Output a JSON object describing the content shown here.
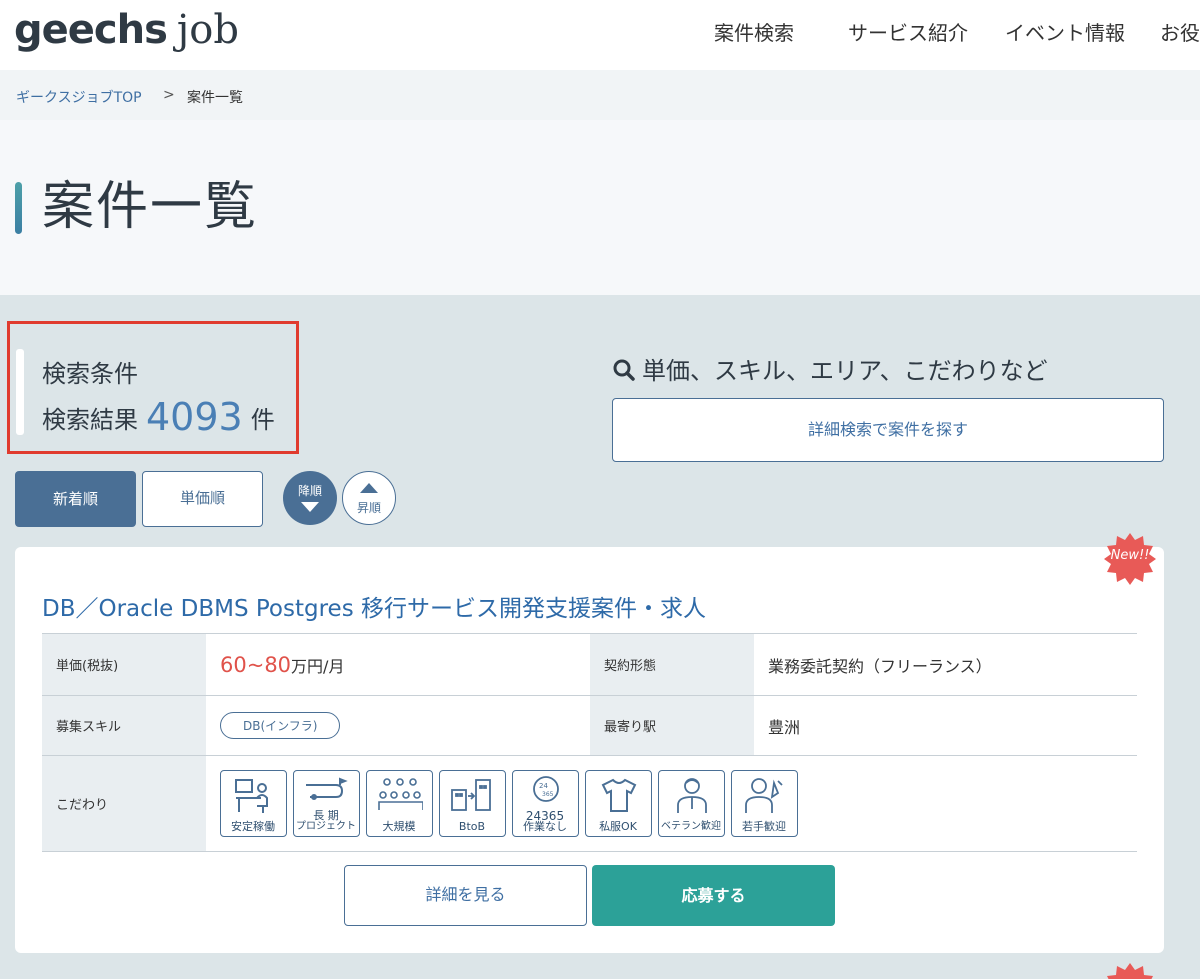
{
  "header": {
    "logo_main": "geechs",
    "logo_sub": "job",
    "nav": [
      "案件検索",
      "サービス紹介",
      "イベント情報",
      "お役"
    ]
  },
  "breadcrumb": {
    "home": "ギークスジョブTOP",
    "separator": ">",
    "current": "案件一覧"
  },
  "page": {
    "title": "案件一覧"
  },
  "search": {
    "conditions_label": "検索条件",
    "results_label": "検索結果",
    "results_count": "4093",
    "results_unit": "件",
    "hint": "単価、スキル、エリア、こだわりなど",
    "detail_button": "詳細検索で案件を探す"
  },
  "sort": {
    "newest": "新着順",
    "price": "単価順",
    "desc": "降順",
    "asc": "昇順"
  },
  "job": {
    "badge": "New!!",
    "title": "DB／Oracle DBMS Postgres 移行サービス開発支援案件・求人",
    "price_label": "単価(税抜)",
    "price_value": "60~80",
    "price_unit": "万円/月",
    "contract_label": "契約形態",
    "contract_value": "業務委託契約（フリーランス）",
    "skill_label": "募集スキル",
    "skill_tag": "DB(インフラ)",
    "station_label": "最寄り駅",
    "station_value": "豊洲",
    "features_label": "こだわり",
    "features": [
      "安定稼働",
      "長 期",
      "プロジェクト",
      "大規模",
      "BtoB",
      "24365",
      "作業なし",
      "私服OK",
      "ベテラン歓迎",
      "若手歓迎"
    ],
    "detail_button": "詳細を見る",
    "apply_button": "応募する"
  },
  "colors": {
    "accent": "#4a6f95",
    "apply": "#2ca198",
    "price": "#e0524a",
    "badge": "#e85a57",
    "highlight": "#e03b2e"
  }
}
